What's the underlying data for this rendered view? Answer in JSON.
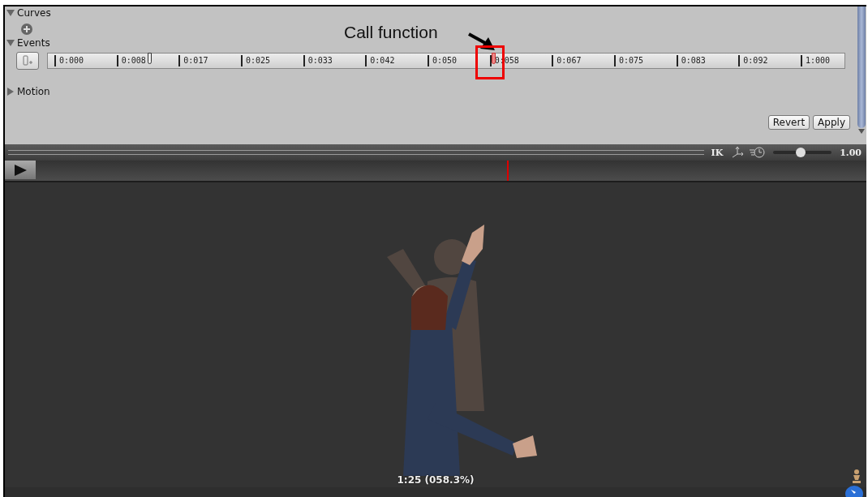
{
  "sections": [
    {
      "label": "Curves",
      "expanded": true
    },
    {
      "label": "Events",
      "expanded": true
    },
    {
      "label": "Motion",
      "expanded": false
    }
  ],
  "events": {
    "ruler_labels": [
      "0:000",
      "0:008",
      "0:017",
      "0:025",
      "0:033",
      "0:042",
      "0:050",
      "0:058",
      "0:067",
      "0:075",
      "0:083",
      "0:092",
      "1:000"
    ],
    "markers": [
      {
        "level": 0.125,
        "selected": false
      },
      {
        "level": 0.586,
        "selected": true
      }
    ]
  },
  "annotation": {
    "text": "Call function"
  },
  "buttons": [
    "Revert",
    "Apply"
  ],
  "toolbar": {
    "ik_label": "IK",
    "speed": {
      "level": 0.47,
      "reading": "1.00"
    }
  },
  "timeline": {
    "playhead": {
      "level": 0.583
    }
  },
  "preview": {
    "caption": "1:25 (058.3%)"
  }
}
